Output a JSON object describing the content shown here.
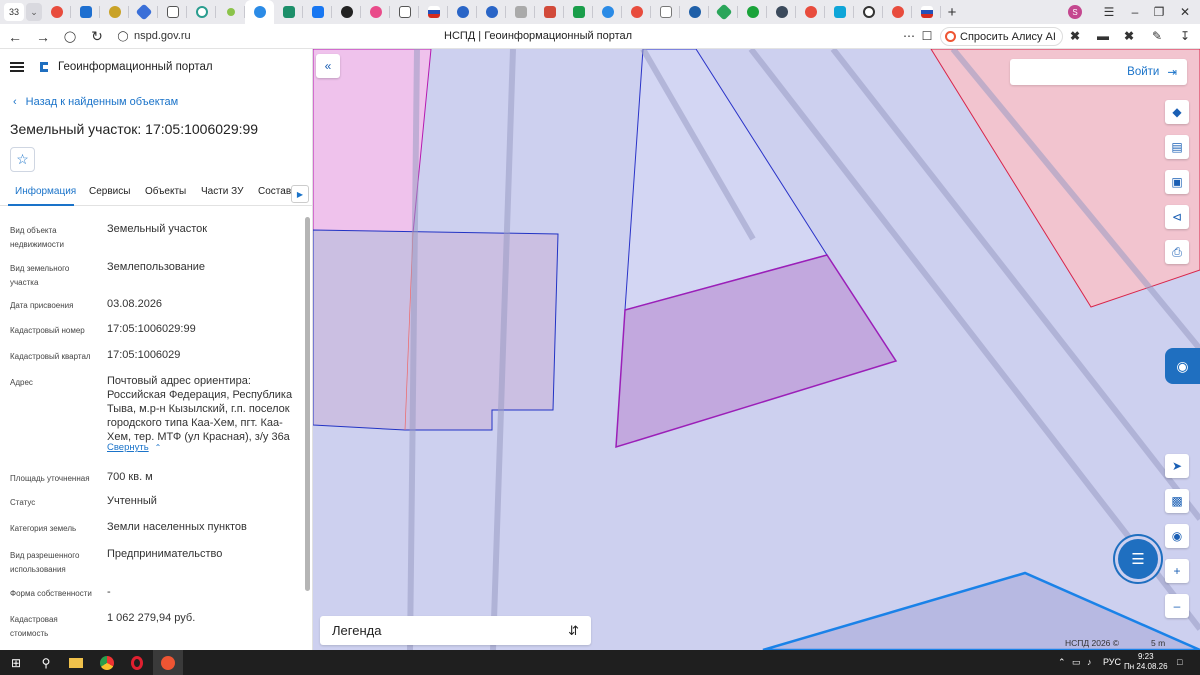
{
  "browser": {
    "tab_count": "33",
    "url": "nspd.gov.ru",
    "page_title": "НСПД | Геоинформационный портал",
    "alice_button": "Спросить Алису AI"
  },
  "panel": {
    "app_title": "Геоинформационный портал",
    "back_label": "Назад к найденным объектам",
    "heading": "Земельный участок: 17:05:1006029:99",
    "tabs": [
      "Информация",
      "Сервисы",
      "Объекты",
      "Части ЗУ",
      "Состав"
    ],
    "fields": [
      {
        "label": "Вид объекта недвижимости",
        "value": "Земельный участок"
      },
      {
        "label": "Вид земельного участка",
        "value": "Землепользование"
      },
      {
        "label": "Дата присвоения",
        "value": "03.08.2026"
      },
      {
        "label": "Кадастровый номер",
        "value": "17:05:1006029:99"
      },
      {
        "label": "Кадастровый квартал",
        "value": "17:05:1006029"
      },
      {
        "label": "Адрес",
        "value": "Почтовый адрес ориентира: Российская Федерация, Республика Тыва, м.р-н Кызылский, г.п. поселок городского типа Каа-Хем, пгт. Каа-Хем, тер. МТФ (ул Красная), з/у 36а"
      },
      {
        "label": "Площадь уточненная",
        "value": "700 кв. м"
      },
      {
        "label": "Статус",
        "value": "Учтенный"
      },
      {
        "label": "Категория земель",
        "value": "Земли населенных пунктов"
      },
      {
        "label": "Вид разрешенного использования",
        "value": "Предпринимательство"
      },
      {
        "label": "Форма собственности",
        "value": "-"
      },
      {
        "label": "Кадастровая стоимость",
        "value": "1 062 279,94 руб."
      }
    ],
    "collapse_label": "Свернуть"
  },
  "map": {
    "login_label": "Войти",
    "legend_label": "Легенда",
    "copyright": "НСПД 2026 ©",
    "scale_label": "5 m"
  },
  "taskbar": {
    "lang": "РУС",
    "time": "9:23",
    "date": "Пн 24.08.26"
  }
}
